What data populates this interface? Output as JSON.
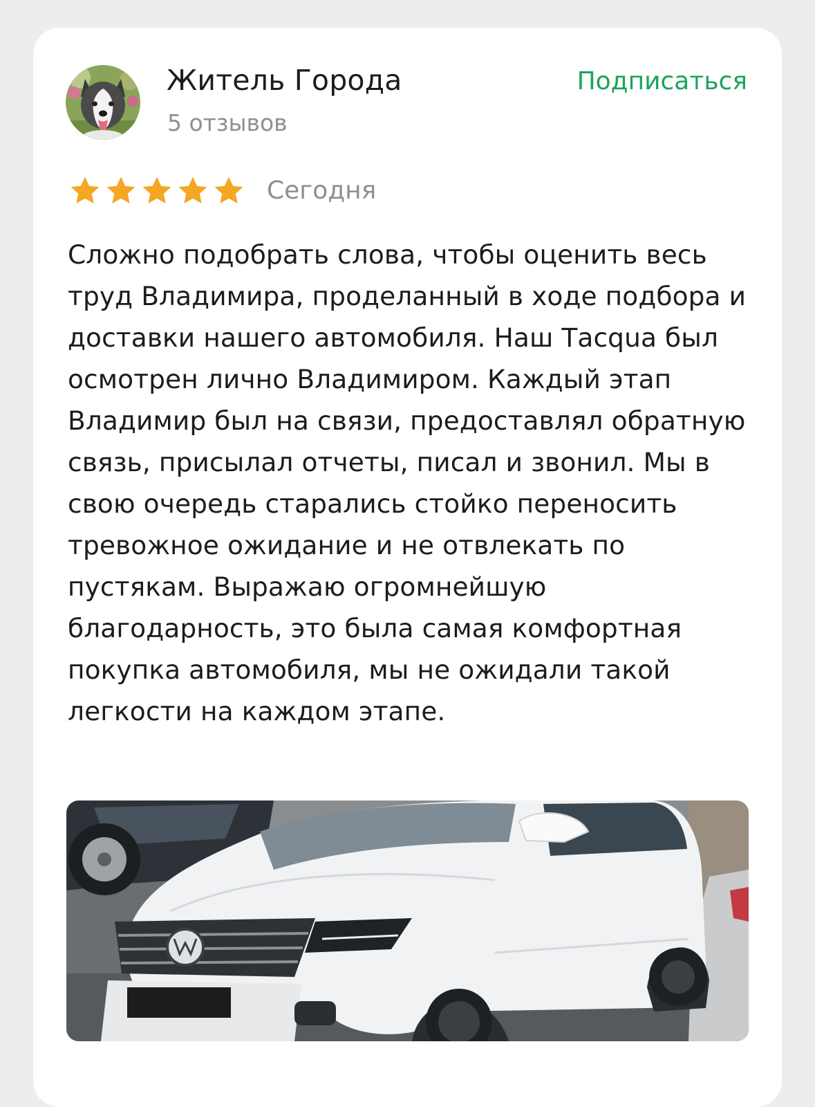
{
  "review": {
    "author": {
      "name": "Житель Города",
      "reviews_count": "5 отзывов",
      "avatar_icon": "husky-dog-avatar"
    },
    "subscribe_label": "Подписаться",
    "rating": {
      "value": 5,
      "max": 5,
      "star_color": "#f5a623"
    },
    "date": "Сегодня",
    "text": "Сложно подобрать слова, чтобы оценить весь труд Владимира, проделанный в ходе подбора и доставки нашего автомобиля. Наш Тacqua был осмотрен лично Владимиром. Каждый этап Владимир был на связи, предоставлял обратную связь, присылал отчеты, писал и звонил. Мы в свою очередь старались стойко переносить тревожное ожидание и не отвлекать по пустякам. Выражаю огромнейшую благодарность, это была самая комфортная покупка автомобиля, мы не ожидали такой легкости на каждом этапе.",
    "photo_icon": "white-volkswagen-suv-photo"
  },
  "colors": {
    "accent": "#1aa45b",
    "muted": "#8e8e93",
    "text": "#1c1c1c"
  }
}
